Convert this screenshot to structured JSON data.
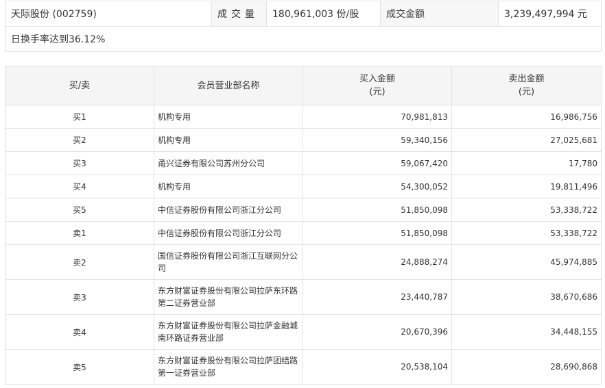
{
  "summary": {
    "stock": "天际股份 (002759)",
    "volume_label": "成交量",
    "volume_value": "180,961,003 份/股",
    "amount_label": "成交金额",
    "amount_value": "3,239,497,994 元",
    "turnover_note": "日换手率达到36.12%"
  },
  "table": {
    "headers": {
      "side": "买/卖",
      "dept": "会员营业部名称",
      "buy": "买入金额",
      "buy_unit": "(元)",
      "sell": "卖出金额",
      "sell_unit": "(元)"
    },
    "rows": [
      {
        "side": "买1",
        "dept": "机构专用",
        "buy": "70,981,813",
        "sell": "16,986,756"
      },
      {
        "side": "买2",
        "dept": "机构专用",
        "buy": "59,340,156",
        "sell": "27,025,681"
      },
      {
        "side": "买3",
        "dept": "甬兴证券有限公司苏州分公司",
        "buy": "59,067,420",
        "sell": "17,780"
      },
      {
        "side": "买4",
        "dept": "机构专用",
        "buy": "54,300,052",
        "sell": "19,811,496"
      },
      {
        "side": "买5",
        "dept": "中信证券股份有限公司浙江分公司",
        "buy": "51,850,098",
        "sell": "53,338,722"
      },
      {
        "side": "卖1",
        "dept": "中信证券股份有限公司浙江分公司",
        "buy": "51,850,098",
        "sell": "53,338,722"
      },
      {
        "side": "卖2",
        "dept_line1": "国信证券股份有限公司浙江互联网分公",
        "dept_line2": "司",
        "buy": "24,888,274",
        "sell": "45,974,885"
      },
      {
        "side": "卖3",
        "dept_line1": "东方财富证券股份有限公司拉萨东环路",
        "dept_line2": "第二证券营业部",
        "buy": "23,440,787",
        "sell": "38,670,686"
      },
      {
        "side": "卖4",
        "dept_line1": "东方财富证券股份有限公司拉萨金融城",
        "dept_line2": "南环路证券营业部",
        "buy": "20,670,396",
        "sell": "34,448,155"
      },
      {
        "side": "卖5",
        "dept_line1": "东方财富证券股份有限公司拉萨团结路",
        "dept_line2": "第一证券营业部",
        "buy": "20,538,104",
        "sell": "28,690,868"
      }
    ]
  }
}
